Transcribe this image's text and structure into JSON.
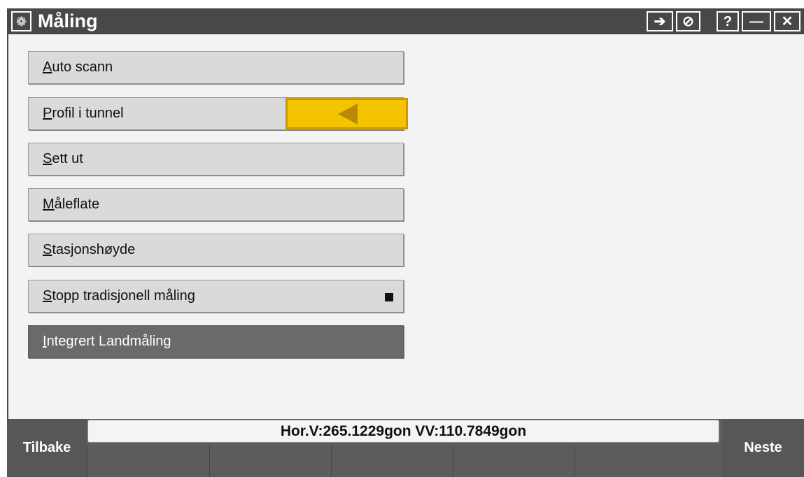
{
  "window": {
    "title": "Måling",
    "app_icon": "trimble-globe-icon",
    "buttons": [
      {
        "name": "login-arrow-icon",
        "glyph": "➔"
      },
      {
        "name": "no-entry-icon",
        "glyph": "⊘"
      },
      {
        "name": "help-button",
        "glyph": "?"
      },
      {
        "name": "minimize-button",
        "glyph": "—"
      },
      {
        "name": "close-button",
        "glyph": "✕"
      }
    ]
  },
  "menu": [
    {
      "label": "Auto scann"
    },
    {
      "label": "Profil i tunnel",
      "highlighted": true
    },
    {
      "label": "Sett ut"
    },
    {
      "label": "Måleflate"
    },
    {
      "label": "Stasjonshøyde"
    },
    {
      "label": "Stopp tradisjonell måling",
      "icon": "stop-square-icon"
    },
    {
      "label": "Integrert Landmåling",
      "selected": true
    }
  ],
  "status": {
    "text": "Hor.V:265.1229gon  VV:110.7849gon"
  },
  "softkeys": {
    "back": "Tilbake",
    "next": "Neste"
  },
  "colors": {
    "titlebar": "#484848",
    "highlight": "#f5c400",
    "selected_item": "#6a6a6a"
  }
}
